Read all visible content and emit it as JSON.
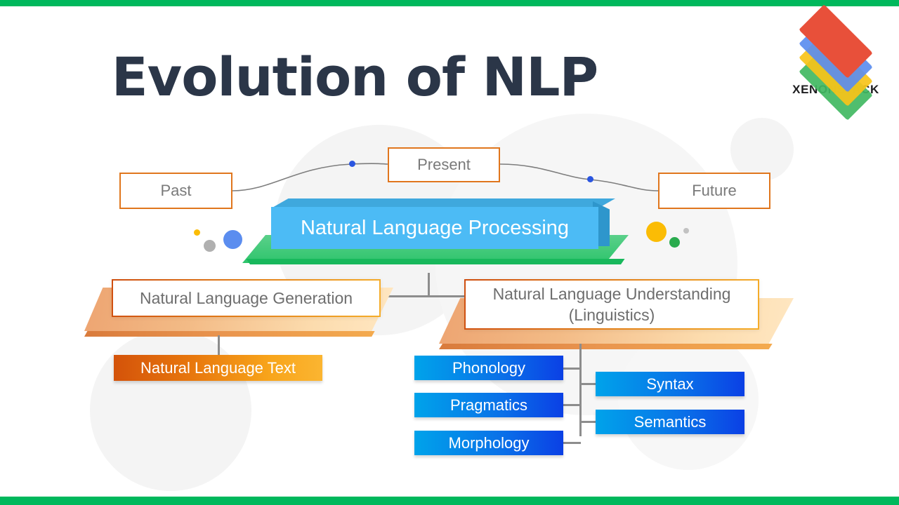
{
  "page": {
    "title": "Evolution of NLP",
    "accent_green": "#00b85c",
    "title_color": "#2b3648"
  },
  "brand": {
    "name": "XENONSTACK",
    "logo_layers": [
      {
        "name": "layer-red",
        "color": "#e8503a"
      },
      {
        "name": "layer-blue",
        "color": "#5b8def"
      },
      {
        "name": "layer-yellow",
        "color": "#f7c319"
      },
      {
        "name": "layer-green",
        "color": "#41b862"
      }
    ]
  },
  "timeline": {
    "items": [
      {
        "label": "Past",
        "border_color": "#e0761d"
      },
      {
        "label": "Present",
        "border_color": "#e0761d"
      },
      {
        "label": "Future",
        "border_color": "#e0761d"
      }
    ],
    "marker_color": "#2a55e0"
  },
  "diagram": {
    "root": {
      "label": "Natural Language Processing",
      "block_color": "#4cbbf5",
      "platform_color": "#2ec46c"
    },
    "branches": [
      {
        "label": "Natural Language Generation",
        "children": [
          {
            "label": "Natural Language Text",
            "color": "#e8780d"
          }
        ]
      },
      {
        "label_line1": "Natural Language Understanding",
        "label_line2": "(Linguistics)",
        "children": [
          {
            "label": "Phonology",
            "color": "#0a6fe8"
          },
          {
            "label": "Pragmatics",
            "color": "#0a6fe8"
          },
          {
            "label": "Morphology",
            "color": "#0a6fe8"
          },
          {
            "label": "Syntax",
            "color": "#0a6fe8"
          },
          {
            "label": "Semantics",
            "color": "#0a6fe8"
          }
        ]
      }
    ]
  }
}
